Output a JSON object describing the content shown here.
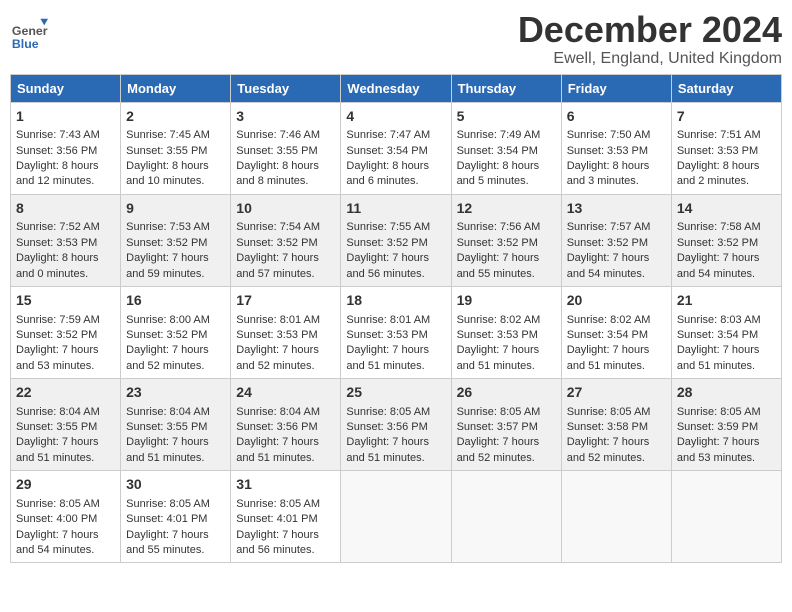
{
  "header": {
    "logo_general": "General",
    "logo_blue": "Blue",
    "title": "December 2024",
    "subtitle": "Ewell, England, United Kingdom"
  },
  "days_of_week": [
    "Sunday",
    "Monday",
    "Tuesday",
    "Wednesday",
    "Thursday",
    "Friday",
    "Saturday"
  ],
  "weeks": [
    [
      {
        "day": 1,
        "info": "Sunrise: 7:43 AM\nSunset: 3:56 PM\nDaylight: 8 hours\nand 12 minutes."
      },
      {
        "day": 2,
        "info": "Sunrise: 7:45 AM\nSunset: 3:55 PM\nDaylight: 8 hours\nand 10 minutes."
      },
      {
        "day": 3,
        "info": "Sunrise: 7:46 AM\nSunset: 3:55 PM\nDaylight: 8 hours\nand 8 minutes."
      },
      {
        "day": 4,
        "info": "Sunrise: 7:47 AM\nSunset: 3:54 PM\nDaylight: 8 hours\nand 6 minutes."
      },
      {
        "day": 5,
        "info": "Sunrise: 7:49 AM\nSunset: 3:54 PM\nDaylight: 8 hours\nand 5 minutes."
      },
      {
        "day": 6,
        "info": "Sunrise: 7:50 AM\nSunset: 3:53 PM\nDaylight: 8 hours\nand 3 minutes."
      },
      {
        "day": 7,
        "info": "Sunrise: 7:51 AM\nSunset: 3:53 PM\nDaylight: 8 hours\nand 2 minutes."
      }
    ],
    [
      {
        "day": 8,
        "info": "Sunrise: 7:52 AM\nSunset: 3:53 PM\nDaylight: 8 hours\nand 0 minutes."
      },
      {
        "day": 9,
        "info": "Sunrise: 7:53 AM\nSunset: 3:52 PM\nDaylight: 7 hours\nand 59 minutes."
      },
      {
        "day": 10,
        "info": "Sunrise: 7:54 AM\nSunset: 3:52 PM\nDaylight: 7 hours\nand 57 minutes."
      },
      {
        "day": 11,
        "info": "Sunrise: 7:55 AM\nSunset: 3:52 PM\nDaylight: 7 hours\nand 56 minutes."
      },
      {
        "day": 12,
        "info": "Sunrise: 7:56 AM\nSunset: 3:52 PM\nDaylight: 7 hours\nand 55 minutes."
      },
      {
        "day": 13,
        "info": "Sunrise: 7:57 AM\nSunset: 3:52 PM\nDaylight: 7 hours\nand 54 minutes."
      },
      {
        "day": 14,
        "info": "Sunrise: 7:58 AM\nSunset: 3:52 PM\nDaylight: 7 hours\nand 54 minutes."
      }
    ],
    [
      {
        "day": 15,
        "info": "Sunrise: 7:59 AM\nSunset: 3:52 PM\nDaylight: 7 hours\nand 53 minutes."
      },
      {
        "day": 16,
        "info": "Sunrise: 8:00 AM\nSunset: 3:52 PM\nDaylight: 7 hours\nand 52 minutes."
      },
      {
        "day": 17,
        "info": "Sunrise: 8:01 AM\nSunset: 3:53 PM\nDaylight: 7 hours\nand 52 minutes."
      },
      {
        "day": 18,
        "info": "Sunrise: 8:01 AM\nSunset: 3:53 PM\nDaylight: 7 hours\nand 51 minutes."
      },
      {
        "day": 19,
        "info": "Sunrise: 8:02 AM\nSunset: 3:53 PM\nDaylight: 7 hours\nand 51 minutes."
      },
      {
        "day": 20,
        "info": "Sunrise: 8:02 AM\nSunset: 3:54 PM\nDaylight: 7 hours\nand 51 minutes."
      },
      {
        "day": 21,
        "info": "Sunrise: 8:03 AM\nSunset: 3:54 PM\nDaylight: 7 hours\nand 51 minutes."
      }
    ],
    [
      {
        "day": 22,
        "info": "Sunrise: 8:04 AM\nSunset: 3:55 PM\nDaylight: 7 hours\nand 51 minutes."
      },
      {
        "day": 23,
        "info": "Sunrise: 8:04 AM\nSunset: 3:55 PM\nDaylight: 7 hours\nand 51 minutes."
      },
      {
        "day": 24,
        "info": "Sunrise: 8:04 AM\nSunset: 3:56 PM\nDaylight: 7 hours\nand 51 minutes."
      },
      {
        "day": 25,
        "info": "Sunrise: 8:05 AM\nSunset: 3:56 PM\nDaylight: 7 hours\nand 51 minutes."
      },
      {
        "day": 26,
        "info": "Sunrise: 8:05 AM\nSunset: 3:57 PM\nDaylight: 7 hours\nand 52 minutes."
      },
      {
        "day": 27,
        "info": "Sunrise: 8:05 AM\nSunset: 3:58 PM\nDaylight: 7 hours\nand 52 minutes."
      },
      {
        "day": 28,
        "info": "Sunrise: 8:05 AM\nSunset: 3:59 PM\nDaylight: 7 hours\nand 53 minutes."
      }
    ],
    [
      {
        "day": 29,
        "info": "Sunrise: 8:05 AM\nSunset: 4:00 PM\nDaylight: 7 hours\nand 54 minutes."
      },
      {
        "day": 30,
        "info": "Sunrise: 8:05 AM\nSunset: 4:01 PM\nDaylight: 7 hours\nand 55 minutes."
      },
      {
        "day": 31,
        "info": "Sunrise: 8:05 AM\nSunset: 4:01 PM\nDaylight: 7 hours\nand 56 minutes."
      },
      null,
      null,
      null,
      null
    ]
  ]
}
